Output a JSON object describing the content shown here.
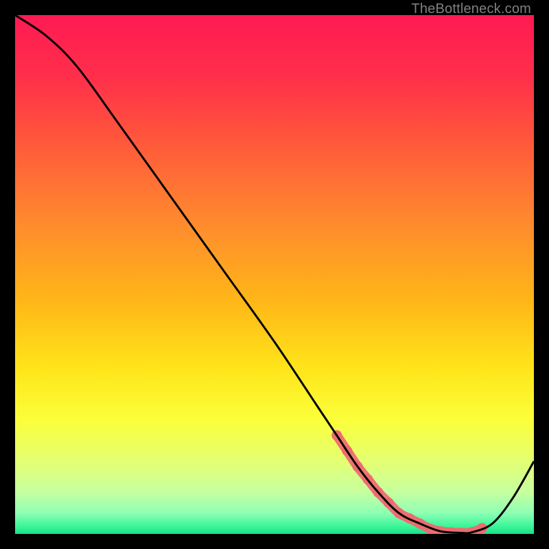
{
  "watermark": "TheBottleneck.com",
  "chart_data": {
    "type": "line",
    "title": "",
    "xlabel": "",
    "ylabel": "",
    "xlim": [
      0,
      100
    ],
    "ylim": [
      0,
      100
    ],
    "series": [
      {
        "name": "curve",
        "x": [
          0,
          6,
          12,
          20,
          30,
          40,
          50,
          58,
          62,
          66,
          70,
          74,
          78,
          82,
          86,
          88,
          92,
          96,
          100
        ],
        "y": [
          100,
          96,
          90,
          79,
          65,
          51,
          37,
          25,
          19,
          13,
          8,
          4,
          2,
          0.5,
          0.2,
          0.3,
          2,
          7,
          14
        ]
      }
    ],
    "highlight_band": {
      "x_start": 62,
      "x_end": 90,
      "dot_xs": [
        62,
        64,
        66,
        68,
        70,
        72,
        74,
        76,
        78,
        80,
        82,
        84,
        86,
        88,
        90
      ],
      "dot_ys": [
        19,
        16,
        13,
        10.5,
        8,
        6,
        4,
        3,
        2,
        1,
        0.5,
        0.3,
        0.2,
        0.3,
        1.1
      ]
    },
    "gradient_stops": [
      {
        "offset": 0.0,
        "color": "#ff1a53"
      },
      {
        "offset": 0.12,
        "color": "#ff2f4a"
      },
      {
        "offset": 0.25,
        "color": "#ff5a3a"
      },
      {
        "offset": 0.4,
        "color": "#ff8a2e"
      },
      {
        "offset": 0.55,
        "color": "#ffb618"
      },
      {
        "offset": 0.68,
        "color": "#ffe41a"
      },
      {
        "offset": 0.78,
        "color": "#fbff3a"
      },
      {
        "offset": 0.86,
        "color": "#e4ff72"
      },
      {
        "offset": 0.92,
        "color": "#c6ffa0"
      },
      {
        "offset": 0.96,
        "color": "#8effb4"
      },
      {
        "offset": 0.985,
        "color": "#3cf59a"
      },
      {
        "offset": 1.0,
        "color": "#18e08a"
      }
    ]
  }
}
